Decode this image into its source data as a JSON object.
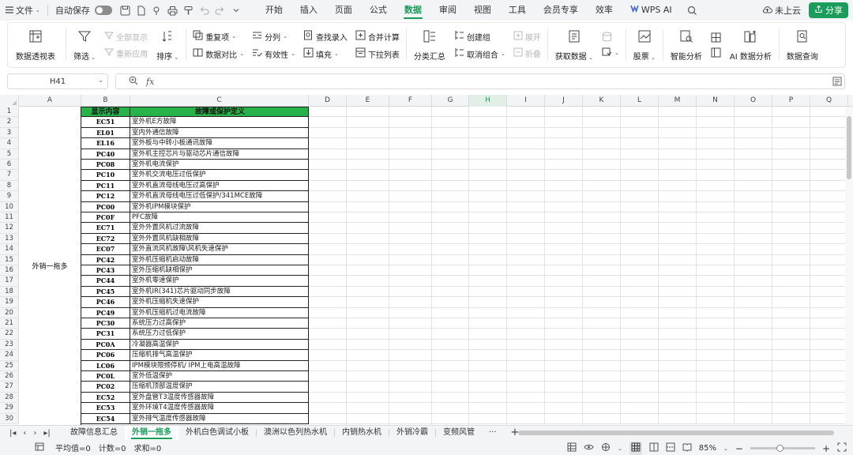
{
  "menubar": {
    "file_label": "文件",
    "autosave_label": "自动保存",
    "tabs": [
      "开始",
      "插入",
      "页面",
      "公式",
      "数据",
      "审阅",
      "视图",
      "工具",
      "会员专享",
      "效率",
      "WPS AI"
    ],
    "active_tab": "数据",
    "cloud_label": "未上云",
    "share_label": "分享",
    "accent_color": "#1a9c5b"
  },
  "ribbon": {
    "pivot": "数据透视表",
    "filter": "筛选",
    "show_all": "全部显示",
    "reapply": "重新应用",
    "sort": "排序",
    "duplicates": "重复项",
    "compare": "数据对比",
    "split": "分列",
    "validity": "有效性",
    "find_entry": "查找录入",
    "fill": "填充",
    "consolidate": "合并计算",
    "dropdown_list": "下拉列表",
    "subtotal": "分类汇总",
    "create_group": "创建组",
    "ungroup": "取消组合",
    "expand": "展开",
    "collapse": "折叠",
    "get_data": "获取数据",
    "stocks": "股票",
    "smart_analysis": "智能分析",
    "ai_analysis": "AI 数据分析",
    "data_query": "数据查询"
  },
  "formula_bar": {
    "cell_ref": "H41",
    "fx_label": "fx",
    "content": ""
  },
  "grid": {
    "columns": [
      "A",
      "B",
      "C",
      "D",
      "E",
      "F",
      "G",
      "H",
      "I",
      "J",
      "K",
      "L",
      "M",
      "N",
      "O",
      "P",
      "Q"
    ],
    "selected_column": "H",
    "row_numbers": [
      "1",
      "2",
      "3",
      "4",
      "5",
      "6",
      "7",
      "8",
      "9",
      "10",
      "11",
      "12",
      "13",
      "14",
      "15",
      "16",
      "17",
      "18",
      "19",
      "20",
      "21",
      "22",
      "23",
      "24",
      "25",
      "26",
      "27",
      "28",
      "29",
      "30"
    ],
    "header_b": "显示内容",
    "header_c": "故障或保护定义",
    "header_fill_color": "#27b24a",
    "merged_a_label": "外销一拖多",
    "rows": [
      {
        "code": "EC51",
        "desc": "室外机E方故障"
      },
      {
        "code": "EL01",
        "desc": "室内外通信故障"
      },
      {
        "code": "EL16",
        "desc": "室外板与中转小板通讯故障"
      },
      {
        "code": "PC40",
        "desc": "室外机主控芯片与驱动芯片通信故障"
      },
      {
        "code": "PC08",
        "desc": "室外机电流保护"
      },
      {
        "code": "PC10",
        "desc": "室外机交流电压过低保护"
      },
      {
        "code": "PC11",
        "desc": "室外机直流母线电压过高保护"
      },
      {
        "code": "PC12",
        "desc": "室外机直流母线电压过低保护/341MCE故障"
      },
      {
        "code": "PC00",
        "desc": "室外机IPM模块保护"
      },
      {
        "code": "PC0F",
        "desc": "PFC故障"
      },
      {
        "code": "EC71",
        "desc": "室外外置风机过流故障"
      },
      {
        "code": "EC72",
        "desc": "室外外置风机缺相故障"
      },
      {
        "code": "EC07",
        "desc": "室外直流风机故障\\风机失速保护"
      },
      {
        "code": "PC42",
        "desc": "室外机压缩机启动故障"
      },
      {
        "code": "PC43",
        "desc": "室外压缩机缺相保护"
      },
      {
        "code": "PC44",
        "desc": "室外机零速保护"
      },
      {
        "code": "PC45",
        "desc": "室外机IR(341)芯片驱动同步故障"
      },
      {
        "code": "PC46",
        "desc": "室外机压缩机失速保护"
      },
      {
        "code": "PC49",
        "desc": "室外机压缩机过电流故障"
      },
      {
        "code": "PC30",
        "desc": "系统压力过高保护"
      },
      {
        "code": "PC31",
        "desc": "系统压力过低保护"
      },
      {
        "code": "PC0A",
        "desc": "冷凝器高温保护"
      },
      {
        "code": "PC06",
        "desc": "压缩机排气高温保护"
      },
      {
        "code": "LC06",
        "desc": "IPM模块限频停机/ IPM上电高温故障"
      },
      {
        "code": "PC0L",
        "desc": "室外低温保护"
      },
      {
        "code": "PC02",
        "desc": "压缩机顶部温度保护"
      },
      {
        "code": "EC52",
        "desc": "室外盘管T3温度传感器故障"
      },
      {
        "code": "EC53",
        "desc": "室外环境T4温度传感器故障"
      },
      {
        "code": "EC54",
        "desc": "室外排气温度传感器故障"
      }
    ]
  },
  "sheets": {
    "tabs": [
      "故障信息汇总",
      "外销一拖多",
      "外机白色调试小板",
      "澳洲以色列热水机",
      "内销热水机",
      "外销冷霸",
      "变频风管"
    ],
    "active": "外销一拖多",
    "more_label": "···",
    "add_label": "+"
  },
  "statusbar": {
    "average": "平均值=0",
    "count": "计数=0",
    "sum": "求和=0",
    "zoom": "85%"
  }
}
